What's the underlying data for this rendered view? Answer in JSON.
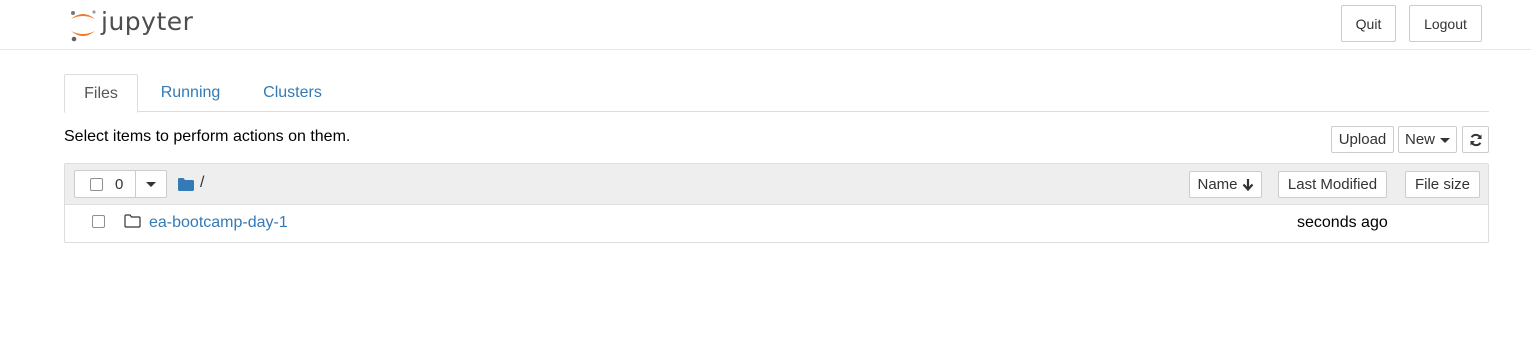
{
  "header": {
    "logo_text": "jupyter",
    "quit_label": "Quit",
    "logout_label": "Logout"
  },
  "tabs": [
    {
      "label": "Files",
      "active": true
    },
    {
      "label": "Running",
      "active": false
    },
    {
      "label": "Clusters",
      "active": false
    }
  ],
  "toolbar": {
    "hint": "Select items to perform actions on them.",
    "upload_label": "Upload",
    "new_label": "New",
    "refresh_icon": "refresh-icon"
  },
  "list": {
    "selected_count": "0",
    "breadcrumb": "/",
    "columns": {
      "name": "Name",
      "last_modified": "Last Modified",
      "file_size": "File size"
    },
    "items": [
      {
        "type": "folder",
        "name": "ea-bootcamp-day-1",
        "modified": "seconds ago",
        "size": ""
      }
    ]
  },
  "colors": {
    "link": "#337ab7",
    "logo_orange": "#f37726",
    "border": "#cccccc",
    "list_header_bg": "#eeeeee"
  }
}
